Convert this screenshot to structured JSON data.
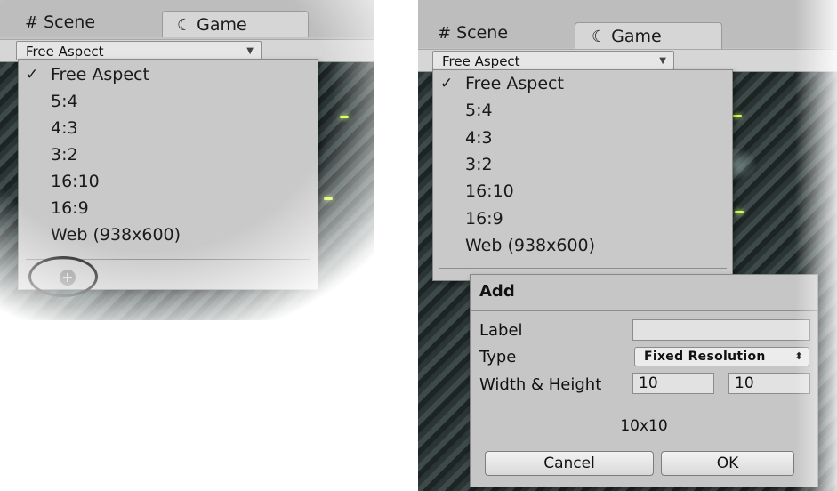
{
  "tabs": {
    "scene": "Scene",
    "game": "Game"
  },
  "aspect_select": {
    "value": "Free Aspect"
  },
  "aspect_menu": {
    "check_mark": "✓",
    "items": [
      "Free Aspect",
      "5:4",
      "4:3",
      "3:2",
      "16:10",
      "16:9",
      "Web (938x600)"
    ],
    "selected_index": 0
  },
  "add_popup": {
    "title": "Add",
    "label_field": {
      "label": "Label",
      "value": ""
    },
    "type_field": {
      "label": "Type",
      "value": "Fixed Resolution"
    },
    "size_field": {
      "label": "Width & Height",
      "width": "10",
      "height": "10"
    },
    "size_readout": "10x10",
    "cancel_label": "Cancel",
    "ok_label": "OK"
  },
  "icons": {
    "scene_tab": "hash-icon",
    "game_tab": "pacman-icon",
    "add": "plus-circle-icon",
    "dropdown": "triangle-down-icon"
  }
}
